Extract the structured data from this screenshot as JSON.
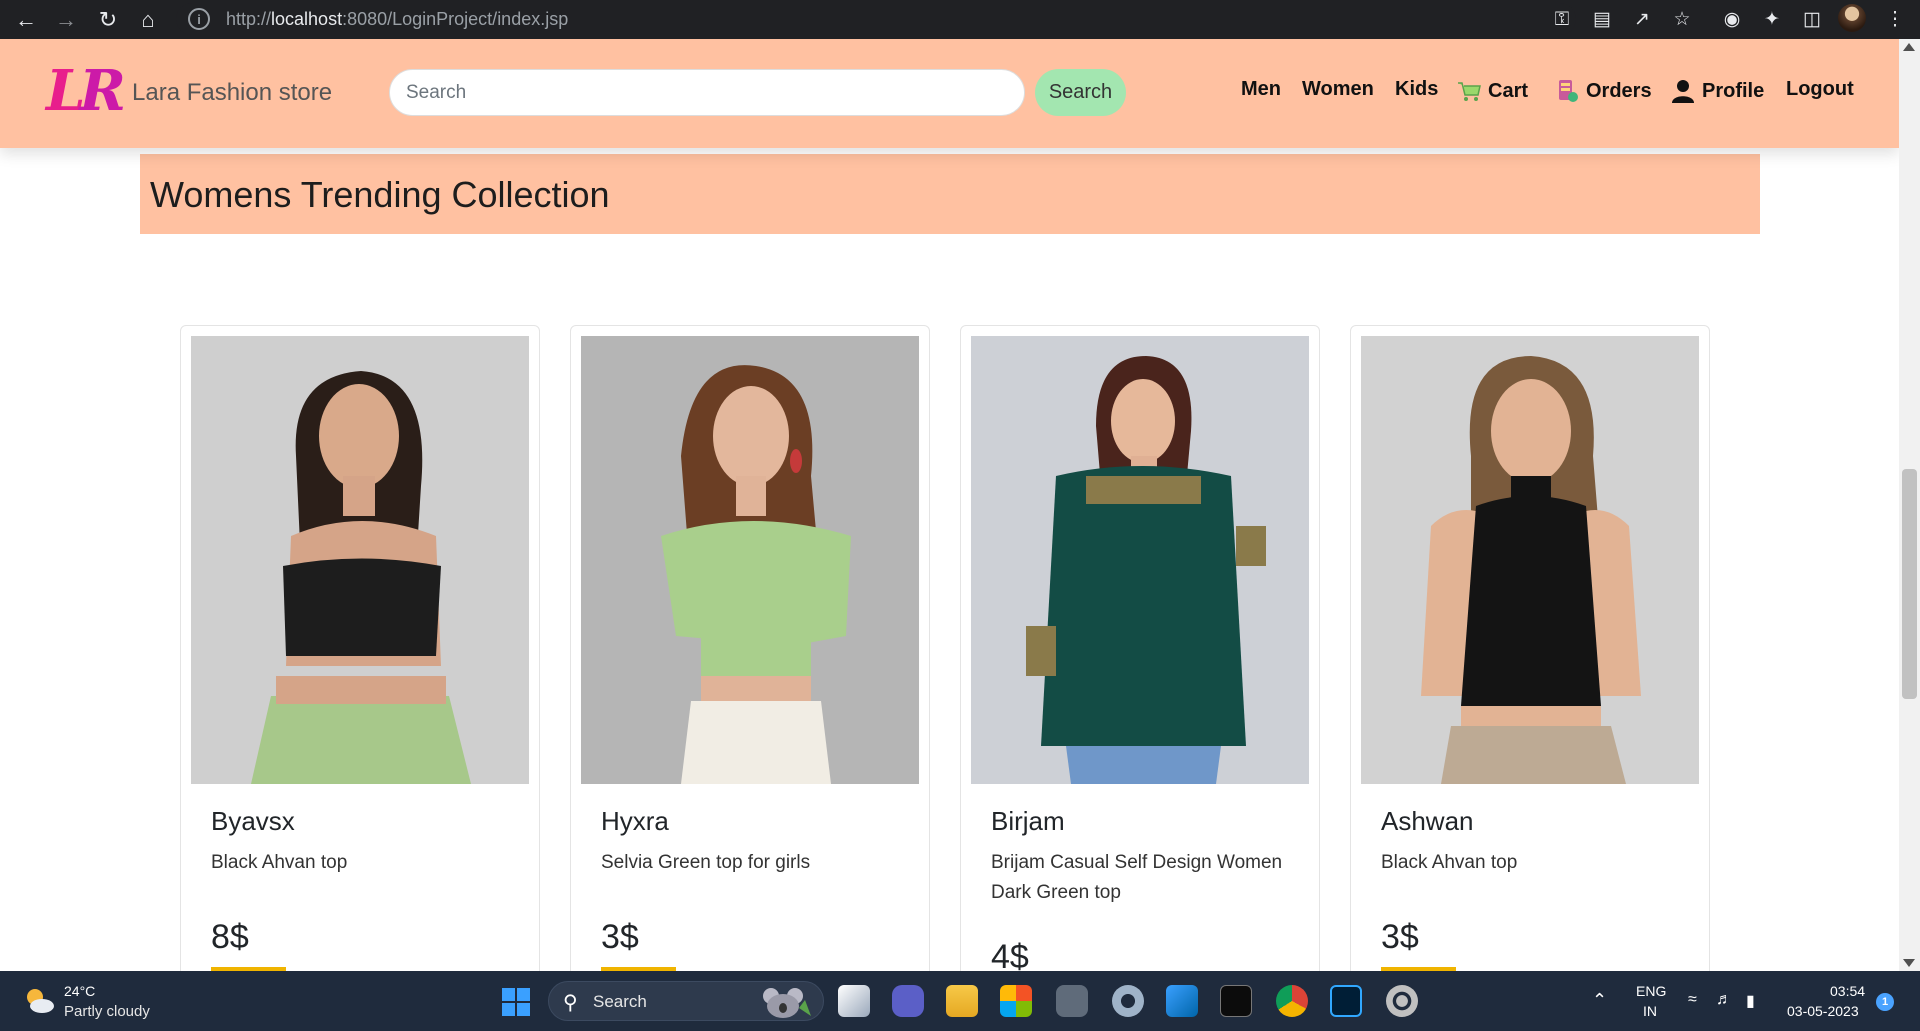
{
  "browser": {
    "url_prefix": "http://",
    "url_host": "localhost",
    "url_path": ":8080/LoginProject/index.jsp"
  },
  "navbar": {
    "logo_l": "L",
    "logo_r": "R",
    "store_name": "Lara Fashion store",
    "search_placeholder": "Search",
    "search_button": "Search",
    "links": {
      "men": "Men",
      "women": "Women",
      "kids": "Kids",
      "cart": "Cart",
      "orders": "Orders",
      "profile": "Profile",
      "logout": "Logout"
    },
    "colors": {
      "background": "#ffc1a1",
      "search_button": "#a3e6b0"
    }
  },
  "banner": {
    "title": "Womens Trending Collection"
  },
  "products": [
    {
      "name": "Byavsx",
      "description": "Black Ahvan top",
      "price": "8$",
      "top_color": "#1d1d1d",
      "bottom_color": "#a7c88a",
      "bg": "#cfcfcf"
    },
    {
      "name": "Hyxra",
      "description": "Selvia Green top for girls",
      "price": "3$",
      "top_color": "#a9cf8c",
      "bottom_color": "#f1ede4",
      "bg": "#b5b5b5"
    },
    {
      "name": "Birjam",
      "description": "Brijam Casual Self Design Women Dark Green top",
      "price": "4$",
      "top_color": "#134c45",
      "bottom_color": "#6f97c9",
      "bg": "#cdd0d6"
    },
    {
      "name": "Ashwan",
      "description": "Black Ahvan top",
      "price": "3$",
      "top_color": "#141414",
      "bottom_color": "#bdaa94",
      "bg": "#d2d2d2"
    }
  ],
  "taskbar": {
    "weather_temp": "24°C",
    "weather_desc": "Partly cloudy",
    "search_label": "Search",
    "lang_line1": "ENG",
    "lang_line2": "IN",
    "time": "03:54",
    "date": "03-05-2023",
    "notification_count": "1"
  }
}
